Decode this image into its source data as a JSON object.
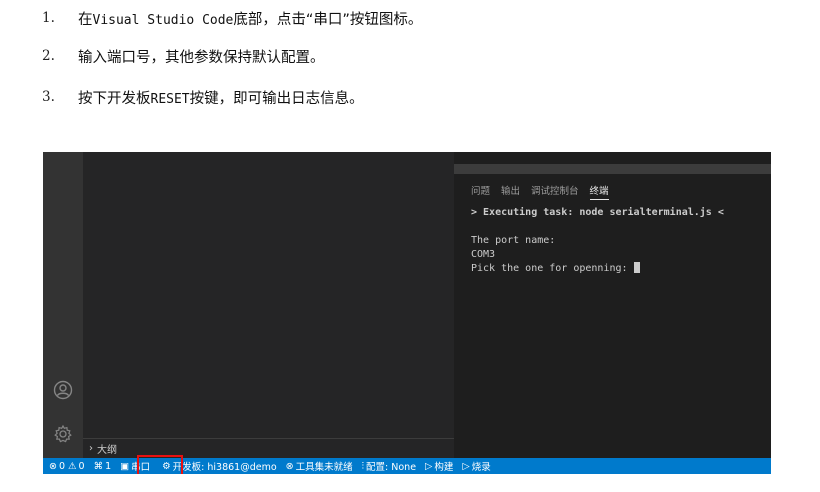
{
  "steps": [
    {
      "num": "1.",
      "parts": [
        {
          "text": "在",
          "mono": false
        },
        {
          "text": "Visual Studio Code",
          "mono": true
        },
        {
          "text": "底部，点击“串口”按钮图标。",
          "mono": false
        }
      ]
    },
    {
      "num": "2.",
      "parts": [
        {
          "text": "输入端口号，其他参数保持默认配置。",
          "mono": false
        }
      ]
    },
    {
      "num": "3.",
      "parts": [
        {
          "text": "按下开发板",
          "mono": false
        },
        {
          "text": "RESET",
          "mono": true
        },
        {
          "text": "按键，即可输出日志信息。",
          "mono": false
        }
      ]
    }
  ],
  "panel": {
    "tabs": [
      "问题",
      "输出",
      "调试控制台",
      "终端"
    ],
    "active_tab": 3
  },
  "terminal": {
    "line1": "> Executing task: node serialterminal.js <",
    "line2": "",
    "line3": "The port name:",
    "line4": "COM3",
    "line5": "Pick the one for openning: "
  },
  "sidebar": {
    "outline_label": "大纲"
  },
  "activity": {
    "account_icon": "account-icon",
    "settings_icon": "gear-icon"
  },
  "statusbar": {
    "errors": "0",
    "warnings": "0",
    "ports": "1",
    "serial": "串口",
    "board": "开发板: hi3861@demo",
    "toolchain": "工具集未就绪",
    "config": "配置: None",
    "build": "构建",
    "burn": "烧录",
    "color": "#007acc",
    "highlight_color": "#e81010"
  }
}
